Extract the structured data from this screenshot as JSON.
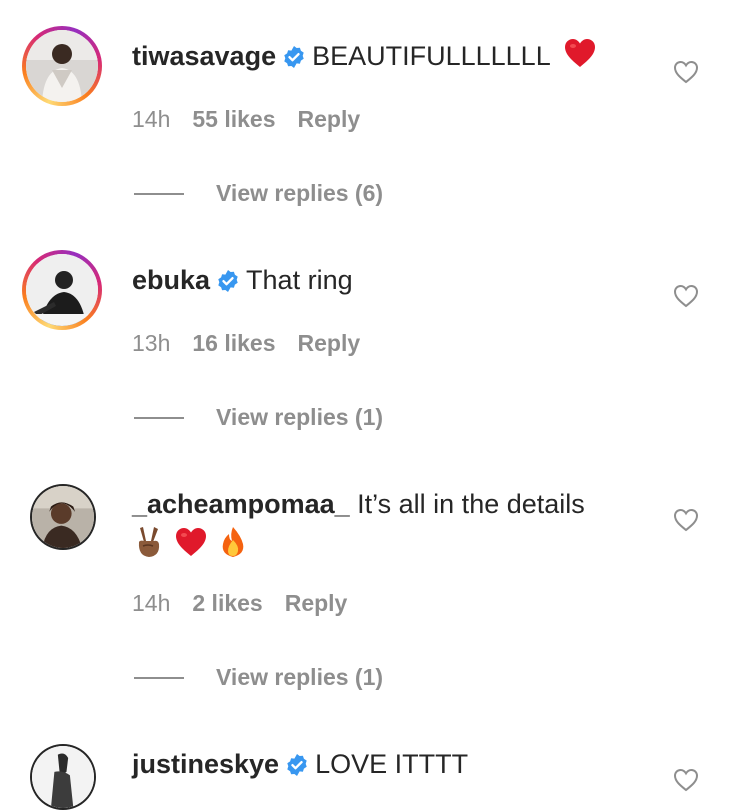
{
  "comments": [
    {
      "username": "tiwasavage",
      "verified": true,
      "text": "BEAUTIFULLLLLLL",
      "emojis": [
        "red-heart"
      ],
      "time": "14h",
      "likes": "55 likes",
      "reply": "Reply",
      "view_replies": "View replies (6)"
    },
    {
      "username": "ebuka",
      "verified": true,
      "text": "That ring",
      "time": "13h",
      "likes": "16 likes",
      "reply": "Reply",
      "view_replies": "View replies (1)"
    },
    {
      "username": "_acheampomaa_",
      "verified": false,
      "text": "It’s all in the details",
      "emojis": [
        "victory-hand",
        "red-heart",
        "fire"
      ],
      "time": "14h",
      "likes": "2 likes",
      "reply": "Reply",
      "view_replies": "View replies (1)"
    },
    {
      "username": "justineskye",
      "verified": true,
      "text": "LOVE ITTTT"
    }
  ],
  "colors": {
    "verified_badge": "#3897f0",
    "meta_text": "#8e8e8e",
    "primary_text": "#262626",
    "emoji_heart": "#e0192b"
  }
}
